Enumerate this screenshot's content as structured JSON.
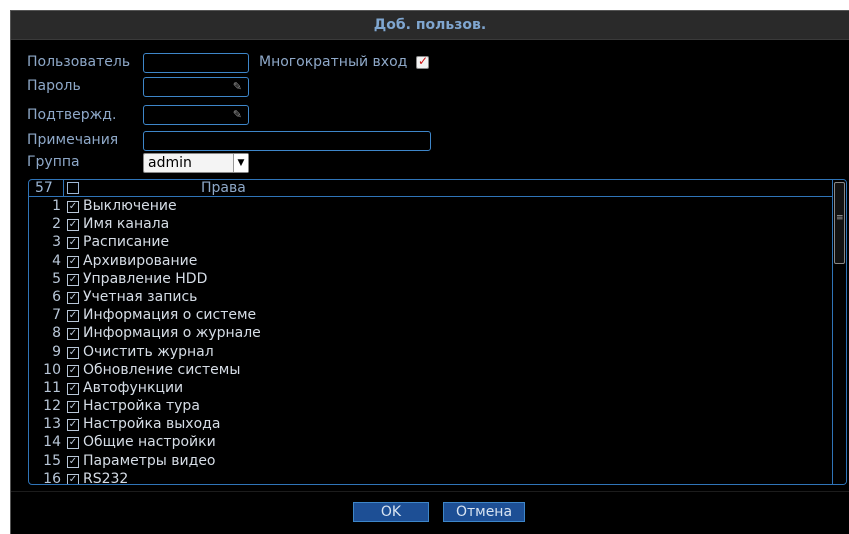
{
  "dialog": {
    "title": "Доб. пользов."
  },
  "form": {
    "user_label": "Пользователь",
    "user_value": "",
    "multi_login_label": "Многократный вход",
    "multi_login_checked": true,
    "password_label": "Пароль",
    "confirm_label": "Подтвержд.",
    "notes_label": "Примечания",
    "notes_value": "",
    "group_label": "Группа",
    "group_value": "admin"
  },
  "rights": {
    "count": "57",
    "header": "Права",
    "rows": [
      {
        "num": "1",
        "label": "Выключение",
        "checked": true
      },
      {
        "num": "2",
        "label": "Имя канала",
        "checked": true
      },
      {
        "num": "3",
        "label": "Расписание",
        "checked": true
      },
      {
        "num": "4",
        "label": "Архивирование",
        "checked": true
      },
      {
        "num": "5",
        "label": "Управление HDD",
        "checked": true
      },
      {
        "num": "6",
        "label": "Учетная запись",
        "checked": true
      },
      {
        "num": "7",
        "label": "Информация о системе",
        "checked": true
      },
      {
        "num": "8",
        "label": "Информация о журнале",
        "checked": true
      },
      {
        "num": "9",
        "label": "Очистить журнал",
        "checked": true
      },
      {
        "num": "10",
        "label": "Обновление системы",
        "checked": true
      },
      {
        "num": "11",
        "label": "Автофункции",
        "checked": true
      },
      {
        "num": "12",
        "label": "Настройка тура",
        "checked": true
      },
      {
        "num": "13",
        "label": "Настройка выхода",
        "checked": true
      },
      {
        "num": "14",
        "label": "Общие настройки",
        "checked": true
      },
      {
        "num": "15",
        "label": "Параметры видео",
        "checked": true
      },
      {
        "num": "16",
        "label": "RS232",
        "checked": true
      }
    ]
  },
  "buttons": {
    "ok": "OK",
    "cancel": "Отмена"
  },
  "colors": {
    "background": "#000000",
    "accent_border": "#3e86c9",
    "button_bg": "#1d4f95",
    "label_text": "#8ea8c8",
    "checkmark_red": "#d01010"
  },
  "icons": {
    "password_visibility": "eye-slash-icon",
    "dropdown": "chevron-down-icon",
    "row_checkbox": "checkbox-checked-icon"
  }
}
